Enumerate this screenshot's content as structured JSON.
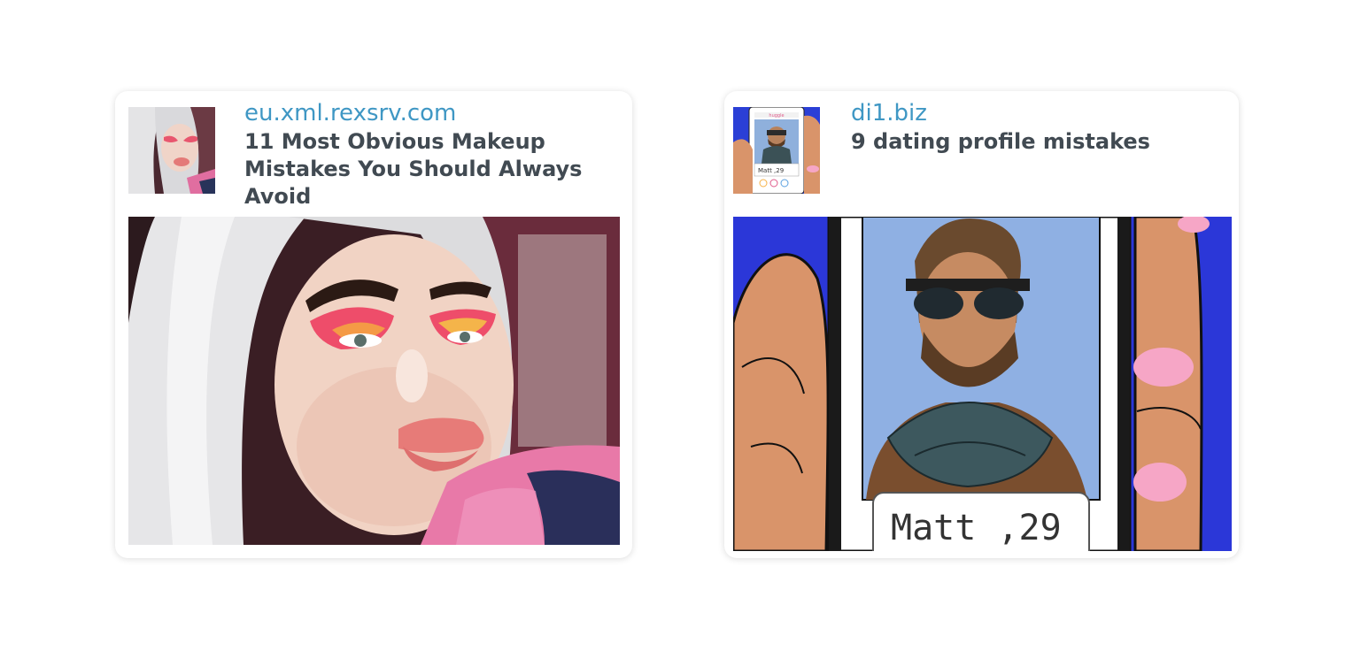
{
  "cards": [
    {
      "source": "eu.xml.rexsrv.com",
      "title": "11 Most Obvious Makeup Mistakes You Should Always Avoid",
      "image": "makeup-selfie-photo"
    },
    {
      "source": "di1.biz",
      "title": "9 dating profile mistakes",
      "image": "dating-app-illustration",
      "profile_caption": "Matt ,29",
      "app_label": "huggle"
    }
  ],
  "colors": {
    "source_link": "#3f97c4",
    "headline": "#414a52",
    "card_background": "#ffffff"
  }
}
